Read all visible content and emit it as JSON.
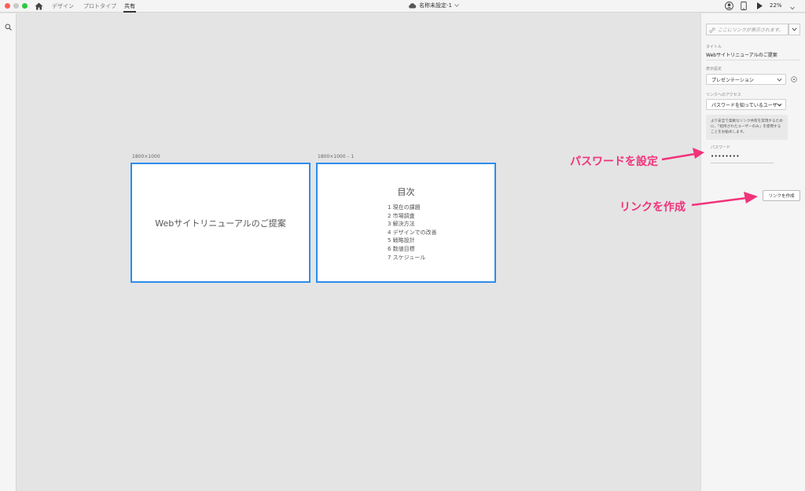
{
  "window": {
    "tabs": [
      {
        "label": "デザイン"
      },
      {
        "label": "プロトタイプ"
      },
      {
        "label": "共有"
      }
    ],
    "document_title": "名称未設定-1",
    "zoom": "22%"
  },
  "artboards": [
    {
      "label": "1800×1000",
      "title": "Webサイトリニューアルのご提案"
    },
    {
      "label": "1800×1000 – 1",
      "title": "目次",
      "items": [
        "1 現在の課題",
        "2 市場調査",
        "3 解決方法",
        "4 デザインでの改善",
        "5 戦略設計",
        "6 数値目標",
        "7 スケジュール"
      ]
    }
  ],
  "panel": {
    "link_placeholder": "ここにリンクが表示されます。",
    "title_label": "タイトル",
    "title_value": "Webサイトリニューアルのご提案",
    "display_label": "表示設定",
    "display_value": "プレゼンテーション",
    "access_label": "リンクへのアクセス",
    "access_value": "パスワードを知っているユーザー",
    "note": "より安全で柔軟なリンク共有を実現するために、「招待されたユーザーのみ」を使用することをお勧めします。",
    "password_label": "パスワード",
    "password_value": "••••••••",
    "create_button": "リンクを作成"
  },
  "annotations": {
    "password": "パスワードを設定",
    "create_link": "リンクを作成",
    "color": "#f0337a"
  },
  "colors": {
    "artboard_border": "#2d8ceb",
    "canvas": "#e4e4e4"
  }
}
